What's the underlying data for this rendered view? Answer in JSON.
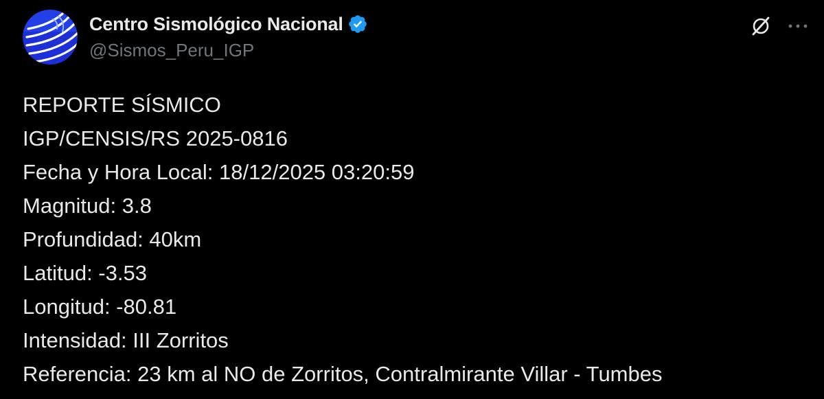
{
  "author": {
    "display_name": "Centro Sismológico Nacional",
    "handle": "@Sismos_Peru_IGP",
    "verified": true,
    "avatar_icon": "igp-logo-icon",
    "verified_icon": "verified-badge-icon",
    "colors": {
      "avatar_bg": "#1d2fd6",
      "verified": "#1d9bf0"
    }
  },
  "actions": {
    "grok_icon": "grok-icon",
    "more_icon": "more-dots-icon"
  },
  "tweet": {
    "lines": [
      "REPORTE SÍSMICO",
      "IGP/CENSIS/RS 2025-0816",
      "Fecha y Hora Local: 18/12/2025 03:20:59",
      "Magnitud: 3.8",
      "Profundidad: 40km",
      "Latitud: -3.53",
      "Longitud: -80.81",
      "Intensidad: III Zorritos",
      "Referencia: 23 km al NO de Zorritos, Contralmirante Villar - Tumbes"
    ]
  },
  "theme": {
    "background": "#000000",
    "text": "#e7e9ea",
    "secondary_text": "#71767b"
  }
}
